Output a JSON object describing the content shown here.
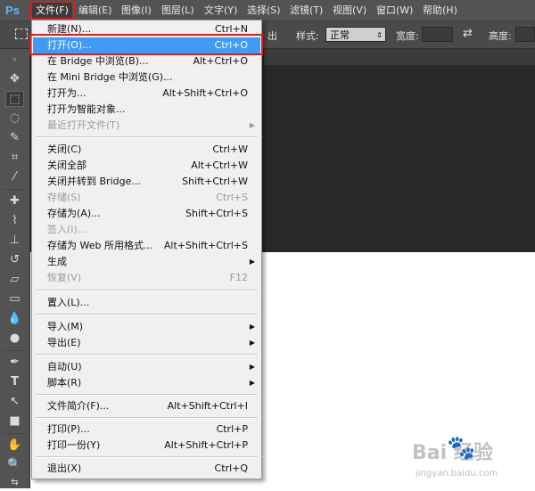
{
  "app": {
    "logo": "Ps"
  },
  "menubar": {
    "items": [
      {
        "label": "文件(F)"
      },
      {
        "label": "编辑(E)"
      },
      {
        "label": "图像(I)"
      },
      {
        "label": "图层(L)"
      },
      {
        "label": "文字(Y)"
      },
      {
        "label": "选择(S)"
      },
      {
        "label": "滤镜(T)"
      },
      {
        "label": "视图(V)"
      },
      {
        "label": "窗口(W)"
      },
      {
        "label": "帮助(H)"
      }
    ]
  },
  "options_bar": {
    "partial_label": "出",
    "style_label": "样式:",
    "style_value": "正常",
    "width_label": "宽度:",
    "height_label": "高度:"
  },
  "file_menu": {
    "items": [
      {
        "label": "新建(N)...",
        "shortcut": "Ctrl+N"
      },
      {
        "label": "打开(O)...",
        "shortcut": "Ctrl+O"
      },
      {
        "label": "在 Bridge 中浏览(B)...",
        "shortcut": "Alt+Ctrl+O"
      },
      {
        "label": "在 Mini Bridge 中浏览(G)...",
        "shortcut": ""
      },
      {
        "label": "打开为...",
        "shortcut": "Alt+Shift+Ctrl+O"
      },
      {
        "label": "打开为智能对象...",
        "shortcut": ""
      },
      {
        "label": "最近打开文件(T)",
        "shortcut": ""
      },
      {
        "label": "关闭(C)",
        "shortcut": "Ctrl+W"
      },
      {
        "label": "关闭全部",
        "shortcut": "Alt+Ctrl+W"
      },
      {
        "label": "关闭并转到 Bridge...",
        "shortcut": "Shift+Ctrl+W"
      },
      {
        "label": "存储(S)",
        "shortcut": "Ctrl+S"
      },
      {
        "label": "存储为(A)...",
        "shortcut": "Shift+Ctrl+S"
      },
      {
        "label": "签入(I)...",
        "shortcut": ""
      },
      {
        "label": "存储为 Web 所用格式...",
        "shortcut": "Alt+Shift+Ctrl+S"
      },
      {
        "label": "生成",
        "shortcut": ""
      },
      {
        "label": "恢复(V)",
        "shortcut": "F12"
      },
      {
        "label": "置入(L)...",
        "shortcut": ""
      },
      {
        "label": "导入(M)",
        "shortcut": ""
      },
      {
        "label": "导出(E)",
        "shortcut": ""
      },
      {
        "label": "自动(U)",
        "shortcut": ""
      },
      {
        "label": "脚本(R)",
        "shortcut": ""
      },
      {
        "label": "文件简介(F)...",
        "shortcut": "Alt+Shift+Ctrl+I"
      },
      {
        "label": "打印(P)...",
        "shortcut": "Ctrl+P"
      },
      {
        "label": "打印一份(Y)",
        "shortcut": "Alt+Shift+Ctrl+P"
      },
      {
        "label": "退出(X)",
        "shortcut": "Ctrl+Q"
      }
    ]
  },
  "watermark": {
    "logo_text": "Bai  经验",
    "url": "jingyan.baidu.com"
  },
  "colors": {
    "highlight": "#3f9bf6",
    "callout_red": "#d1221f",
    "menubar": "#535353"
  }
}
